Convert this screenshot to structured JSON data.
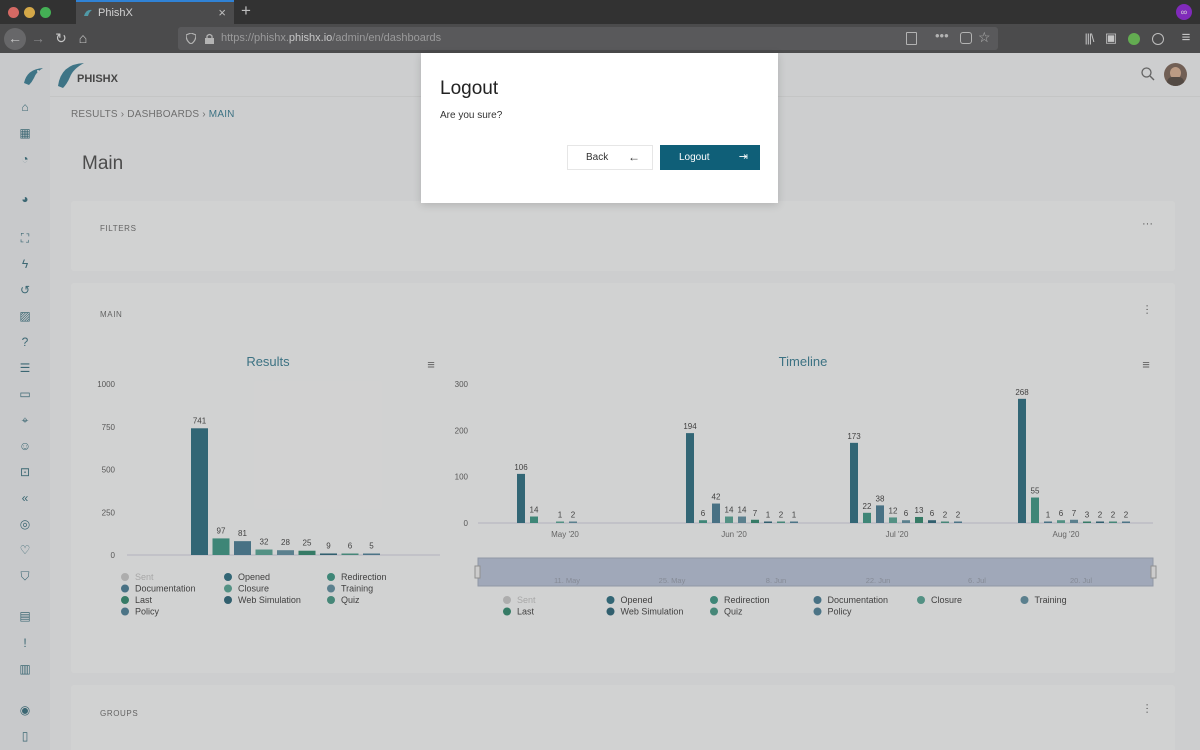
{
  "browser": {
    "tab_title": "PhishX",
    "tab_close": "×",
    "new_tab": "+",
    "url_prefix": "https://phishx.",
    "url_domain": "phishx.io",
    "url_path": "/admin/en/dashboards"
  },
  "app": {
    "brand": "PHISHX",
    "breadcrumb": [
      "RESULTS",
      "DASHBOARDS",
      "MAIN"
    ],
    "page_title": "Main",
    "filters_label": "FILTERS",
    "main_label": "MAIN",
    "groups_label": "GROUPS",
    "card_menu": "···"
  },
  "colors": {
    "accent": "#0f5f78",
    "dark_teal": "#0d5a71",
    "teal": "#1e8a74",
    "slate": "#2d6b86",
    "gray": "#c4c4c4"
  },
  "chart_data": [
    {
      "type": "bar",
      "title": "Results",
      "ylim": [
        0,
        1000
      ],
      "yticks": [
        "1000",
        "750",
        "500",
        "250",
        "0"
      ],
      "categories": [
        "Sent",
        "Opened",
        "Redirection",
        "Documentation",
        "Closure",
        "Training",
        "Last",
        "Web Simulation",
        "Quiz",
        "Policy"
      ],
      "values": [
        null,
        741,
        97,
        81,
        32,
        28,
        25,
        9,
        6,
        5
      ],
      "legend": [
        [
          "Sent",
          "Opened",
          "Redirection"
        ],
        [
          "Documentation",
          "Closure",
          "Training"
        ],
        [
          "Last",
          "Web Simulation",
          "Quiz"
        ],
        [
          "Policy"
        ]
      ]
    },
    {
      "type": "bar",
      "title": "Timeline",
      "ylim": [
        0,
        300
      ],
      "yticks": [
        "300",
        "200",
        "100",
        "0"
      ],
      "x_labels": [
        "May '20",
        "Jun '20",
        "Jul '20",
        "Aug '20"
      ],
      "navigator_labels": [
        "11. May",
        "25. May",
        "8. Jun",
        "22. Jun",
        "6. Jul",
        "20. Jul"
      ],
      "groups": [
        {
          "values": [
            106,
            14,
            null,
            1,
            2
          ]
        },
        {
          "values": [
            194,
            6,
            42,
            14,
            14,
            7,
            1,
            2,
            1
          ]
        },
        {
          "values": [
            173,
            22,
            38,
            12,
            6,
            13,
            6,
            2,
            2
          ]
        },
        {
          "values": [
            268,
            55,
            1,
            6,
            7,
            3,
            2,
            2,
            2
          ]
        }
      ],
      "legend": [
        [
          "Sent",
          "Opened",
          "Redirection",
          "Documentation",
          "Closure",
          "Training"
        ],
        [
          "Last",
          "Web Simulation",
          "Quiz",
          "Policy"
        ]
      ]
    }
  ],
  "modal": {
    "title": "Logout",
    "message": "Are you sure?",
    "back_label": "Back",
    "logout_label": "Logout",
    "back_icon": "←",
    "logout_icon": "⇥"
  }
}
